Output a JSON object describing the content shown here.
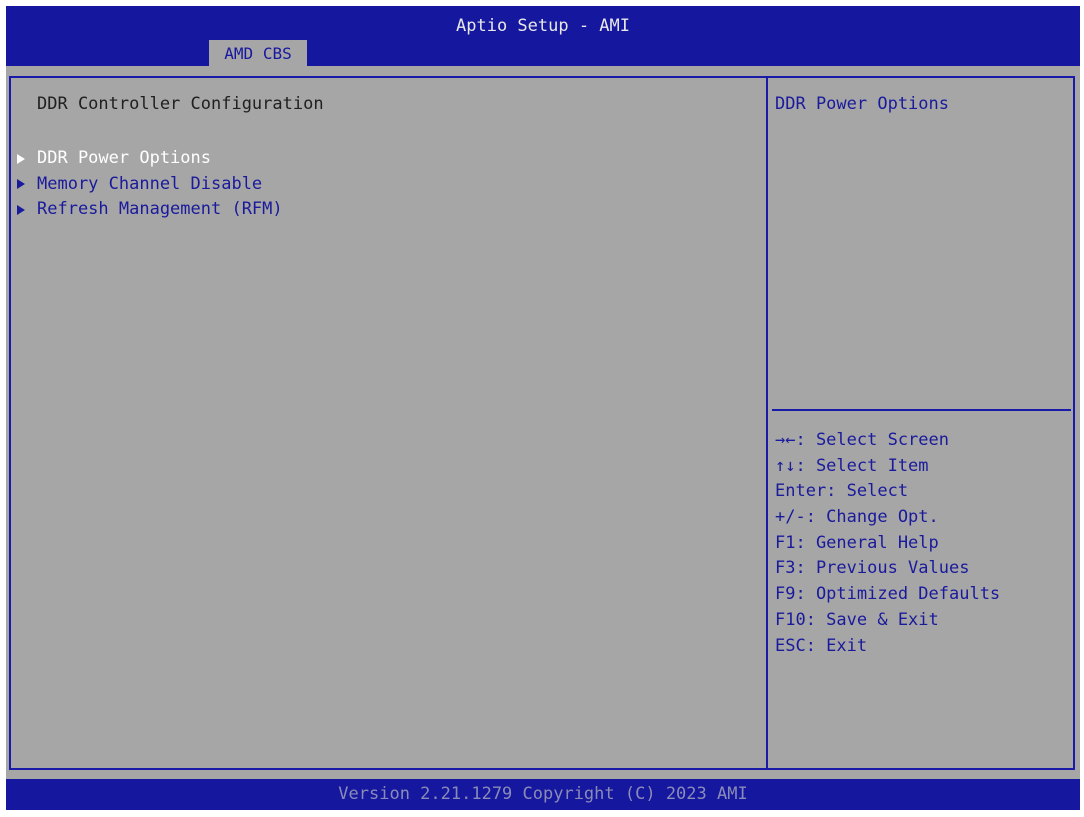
{
  "header": {
    "app_title": "Aptio Setup - AMI",
    "active_tab": "AMD CBS"
  },
  "main": {
    "section_title": "DDR Controller Configuration",
    "menu_items": [
      {
        "label": "DDR Power Options",
        "selected": true
      },
      {
        "label": "Memory Channel Disable",
        "selected": false
      },
      {
        "label": "Refresh Management (RFM)",
        "selected": false
      }
    ]
  },
  "help_panel": {
    "description": "DDR Power Options",
    "keys": [
      "→←: Select Screen",
      "↑↓: Select Item",
      "Enter: Select",
      "+/-: Change Opt.",
      "F1: General Help",
      "F3: Previous Values",
      "F9: Optimized Defaults",
      "F10: Save & Exit",
      "ESC: Exit"
    ]
  },
  "footer": {
    "version": "Version 2.21.1279 Copyright (C) 2023 AMI"
  },
  "colors": {
    "header_bg": "#15179e",
    "panel_bg": "#a6a6a6",
    "text_blue": "#1a1a9c",
    "highlight": "#ffffff"
  },
  "icons": {
    "submenu": "triangle-right-icon"
  }
}
